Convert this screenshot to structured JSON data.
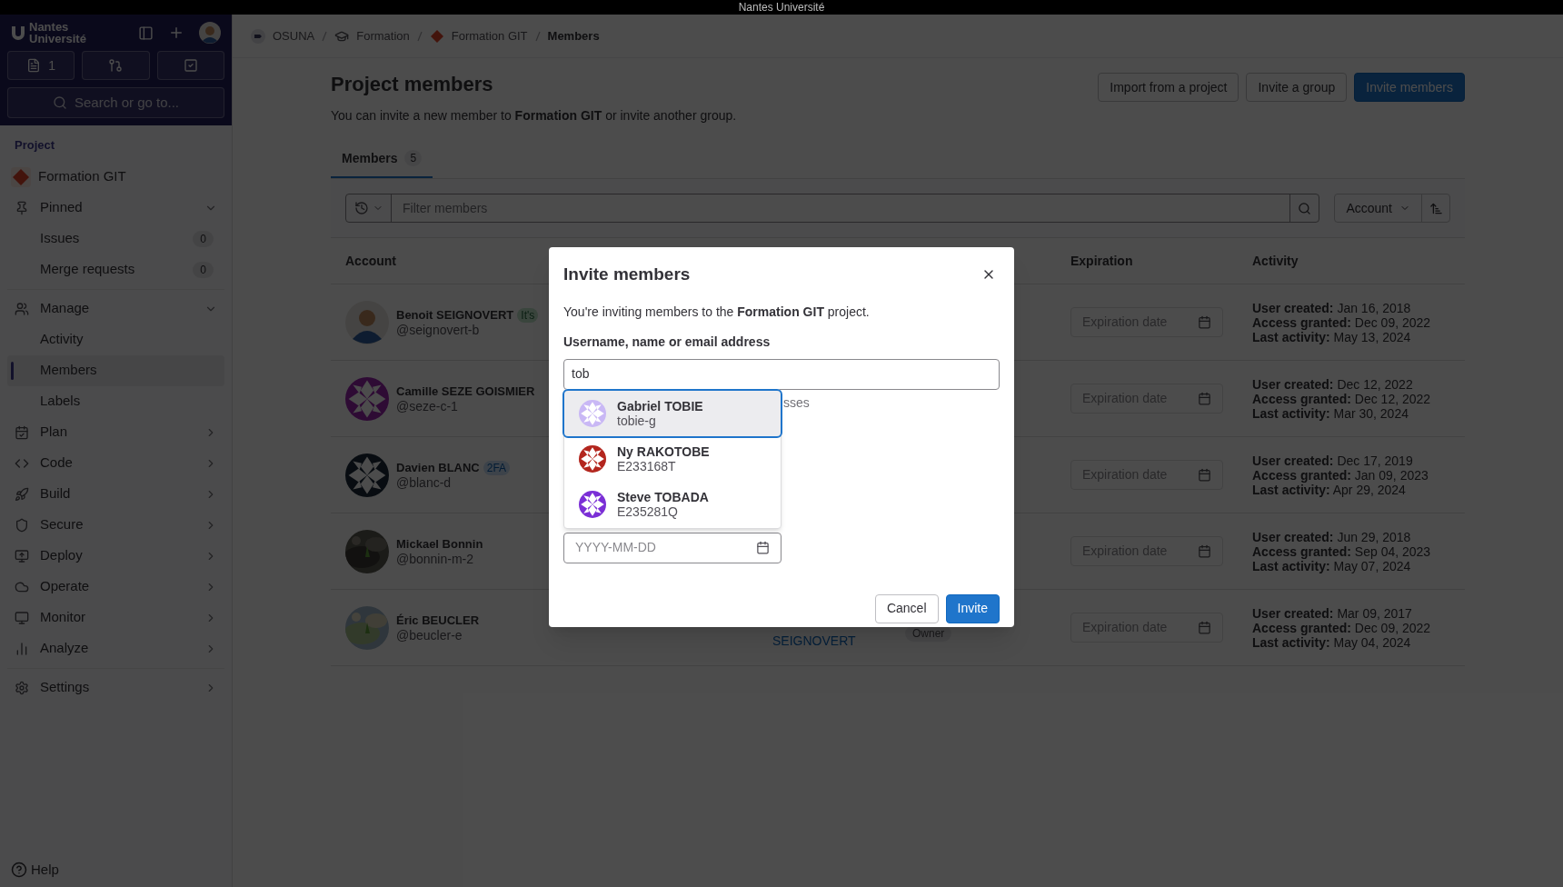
{
  "title_bar": {
    "title": "Nantes Université"
  },
  "sidebar": {
    "logo": "Nantes Université",
    "issues_count": "1",
    "search": {
      "placeholder": "Search or go to..."
    },
    "section": "Project",
    "project": "Formation GIT",
    "items": [
      {
        "label": "Pinned",
        "expanded": true,
        "children": [
          {
            "label": "Issues",
            "count": "0",
            "selected": false
          },
          {
            "label": "Merge requests",
            "count": "0",
            "selected": false
          }
        ]
      },
      {
        "label": "Manage",
        "expanded": true,
        "children": [
          {
            "label": "Activity",
            "selected": false
          },
          {
            "label": "Members",
            "selected": true
          },
          {
            "label": "Labels",
            "selected": false
          }
        ]
      },
      {
        "label": "Plan",
        "expanded": false
      },
      {
        "label": "Code",
        "expanded": false
      },
      {
        "label": "Build",
        "expanded": false
      },
      {
        "label": "Secure",
        "expanded": false
      },
      {
        "label": "Deploy",
        "expanded": false
      },
      {
        "label": "Operate",
        "expanded": false
      },
      {
        "label": "Monitor",
        "expanded": false
      },
      {
        "label": "Analyze",
        "expanded": false
      },
      {
        "label": "Settings",
        "expanded": false
      }
    ],
    "help": "Help"
  },
  "breadcrumb": [
    {
      "label": "OSUNA"
    },
    {
      "label": "Formation"
    },
    {
      "label": "Formation GIT"
    },
    {
      "label": "Members"
    }
  ],
  "page": {
    "title": "Project members",
    "subtitle": "You can invite a new member to **Formation GIT** or invite another group.",
    "buttons": [
      {
        "label": "Import from a project",
        "primary": false
      },
      {
        "label": "Invite a group",
        "primary": false
      },
      {
        "label": "Invite members",
        "primary": true
      }
    ]
  },
  "tabs": [
    {
      "label": "Members",
      "count": "5",
      "selected": true
    }
  ],
  "filter": {
    "placeholder": "Filter members",
    "sort": "Account"
  },
  "table": {
    "columns": [
      "Account",
      "Expiration",
      "Activity"
    ],
    "rows": [
      {
        "name": "Benoit SEIGNOVERT",
        "username": "@seignovert-b",
        "badge": "It's",
        "avatar": {
          "kind": "silhouette"
        },
        "expiration": "Expiration date",
        "activity": [
          {
            "label": "User created:",
            "value": "Jan 16, 2018"
          },
          {
            "label": "Access granted:",
            "value": "Dec 09, 2022"
          },
          {
            "label": "Last activity:",
            "value": "May 13, 2024"
          }
        ]
      },
      {
        "name": "Camille SEZE GOISMIER",
        "username": "@seze-c-1",
        "avatar": {
          "kind": "identicon"
        },
        "expiration": "Expiration date",
        "activity": [
          {
            "label": "User created:",
            "value": "Dec 12, 2022"
          },
          {
            "label": "Access granted:",
            "value": "Dec 12, 2022"
          },
          {
            "label": "Last activity:",
            "value": "Mar 30, 2024"
          }
        ]
      },
      {
        "name": "Davien BLANC",
        "username": "@blanc-d",
        "badge": "2FA",
        "avatar": {
          "kind": "identicon"
        },
        "expiration": "Expiration date",
        "activity": [
          {
            "label": "User created:",
            "value": "Dec 17, 2019"
          },
          {
            "label": "Access granted:",
            "value": "Jan 09, 2023"
          },
          {
            "label": "Last activity:",
            "value": "Apr 29, 2024"
          }
        ]
      },
      {
        "name": "Mickael Bonnin",
        "username": "@bonnin-m-2",
        "avatar": {
          "kind": "picture"
        },
        "expiration": "Expiration date",
        "activity": [
          {
            "label": "User created:",
            "value": "Jun 29, 2018"
          },
          {
            "label": "Access granted:",
            "value": "Sep 04, 2023"
          },
          {
            "label": "Last activity:",
            "value": "May 07, 2024"
          }
        ]
      },
      {
        "name": "Éric BEUCLER",
        "username": "@beucler-e",
        "avatar": {
          "kind": "picture"
        },
        "source": "SEIGNOVERT",
        "role": "Owner",
        "expiration": "Expiration date",
        "activity": [
          {
            "label": "User created:",
            "value": "Mar 09, 2017"
          },
          {
            "label": "Access granted:",
            "value": "Dec 09, 2022"
          },
          {
            "label": "Last activity:",
            "value": "May 04, 2024"
          }
        ]
      }
    ]
  },
  "modal": {
    "title": "Invite members",
    "intro": "You're inviting members to the **Formation GIT** project.",
    "field_label": "Username, name or email address",
    "value": "tob",
    "hint": "sses",
    "date_placeholder": "YYYY-MM-DD",
    "suggestions": [
      {
        "name": "Gabriel TOBIE",
        "username": "tobie-g",
        "color": "#c9b8f5",
        "selected": true
      },
      {
        "name": "Ny RAKOTOBE",
        "username": "E233168T",
        "color": "#b3261e",
        "selected": false
      },
      {
        "name": "Steve TOBADA",
        "username": "E235281Q",
        "color": "#7b2fd6",
        "selected": false
      }
    ],
    "buttons": [
      {
        "label": "Cancel",
        "primary": false
      },
      {
        "label": "Invite",
        "primary": true
      }
    ]
  }
}
